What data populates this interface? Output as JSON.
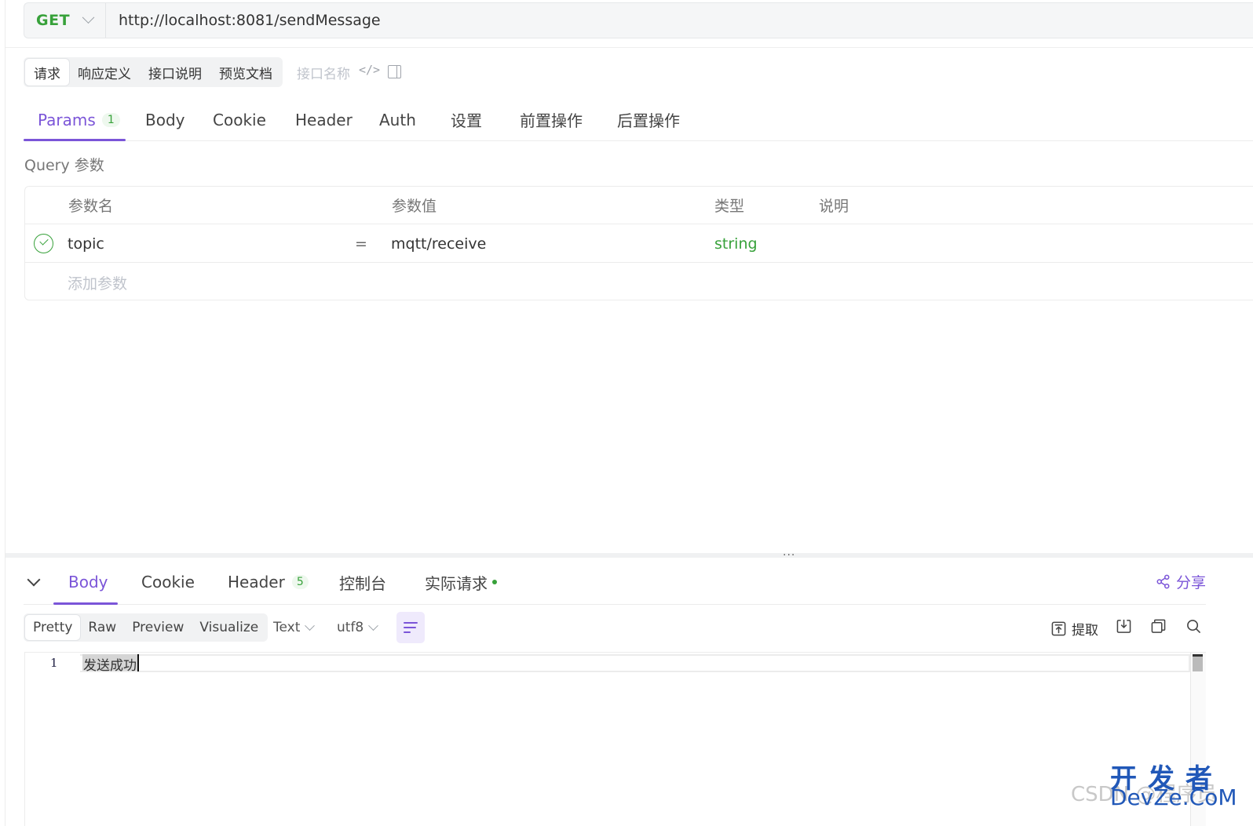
{
  "request": {
    "method": "GET",
    "url": "http://localhost:8081/sendMessage"
  },
  "request_segments": [
    "请求",
    "响应定义",
    "接口说明",
    "预览文档"
  ],
  "api_name_placeholder": "接口名称",
  "request_tabs": {
    "params": "Params",
    "params_count": "1",
    "body": "Body",
    "cookie": "Cookie",
    "header": "Header",
    "auth": "Auth",
    "settings": "设置",
    "pre_ops": "前置操作",
    "post_ops": "后置操作"
  },
  "query_section_label": "Query 参数",
  "params_table": {
    "headers": {
      "name": "参数名",
      "value": "参数值",
      "type": "类型",
      "desc": "说明"
    },
    "rows": [
      {
        "name": "topic",
        "op": "=",
        "value": "mqtt/receive",
        "type": "string",
        "desc": ""
      }
    ],
    "add_placeholder": "添加参数"
  },
  "splitter_handle": "···",
  "response_tabs": {
    "body": "Body",
    "cookie": "Cookie",
    "header": "Header",
    "header_count": "5",
    "console": "控制台",
    "actual_request": "实际请求"
  },
  "share_label": "分享",
  "view_modes": [
    "Pretty",
    "Raw",
    "Preview",
    "Visualize"
  ],
  "format_select": "Text",
  "encoding_select": "utf8",
  "toolbar": {
    "extract": "提取"
  },
  "editor": {
    "line_number": "1",
    "content": "发送成功"
  },
  "watermark": {
    "csdn": "CSDN @程序员",
    "cn": "开发者",
    "en": "DevZe.CoM"
  },
  "colors": {
    "accent": "#7b55d8",
    "method_get": "#37a13a",
    "type_string": "#37a13a"
  }
}
